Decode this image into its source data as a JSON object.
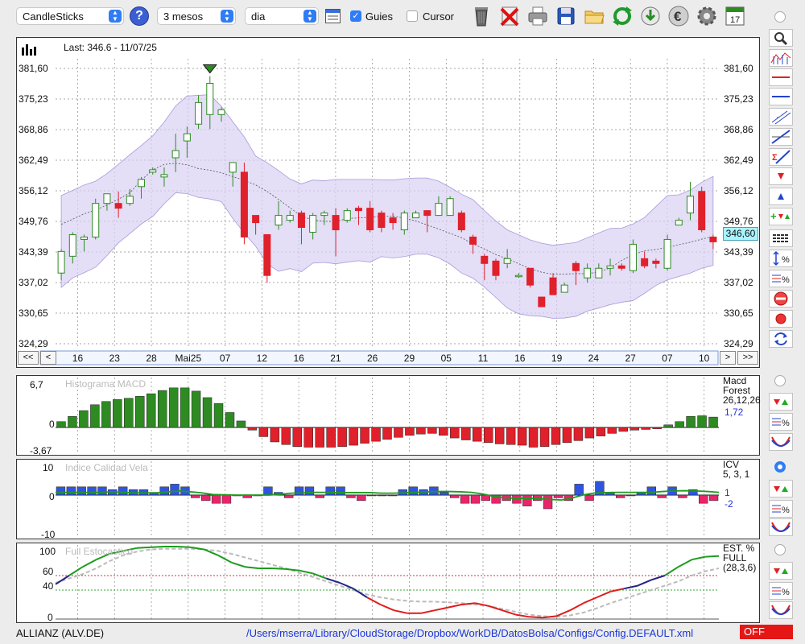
{
  "toolbar": {
    "chart_type": "CandleSticks",
    "period": "3 mesos",
    "interval": "dia",
    "guides_label": "Guies",
    "guides_checked": true,
    "cursor_label": "Cursor",
    "cursor_checked": false,
    "calendar_day": "17",
    "icons": [
      "help-icon",
      "table-icon",
      "trash-icon",
      "delete-icon",
      "print-icon",
      "save-icon",
      "folder-icon",
      "refresh-icon",
      "download-icon",
      "currency-icon",
      "settings-icon",
      "calendar-icon"
    ]
  },
  "main_chart": {
    "last_label": "Last: 346.6 - 11/07/25",
    "current_price": "346,60",
    "y_ticks": [
      "381,60",
      "375,23",
      "368,86",
      "362,49",
      "356,12",
      "349,76",
      "343,39",
      "337,02",
      "330,65",
      "324,29"
    ],
    "x_labels": [
      "16",
      "23",
      "28",
      "Mai25",
      "07",
      "12",
      "16",
      "21",
      "26",
      "29",
      "05",
      "11",
      "16",
      "19",
      "24",
      "27",
      "07",
      "10"
    ],
    "nav": {
      "first": "<<",
      "prev": "<",
      "next": ">",
      "last": ">>"
    },
    "colors": {
      "up": "#2e8b22",
      "down": "#e0202a",
      "band": "#d8d0f4",
      "band_edge": "#a89ad8",
      "accent": "#2f7cf6"
    }
  },
  "chart_data": [
    {
      "type": "candlestick",
      "title": "Last: 346.6 - 11/07/25",
      "ylim": [
        324.29,
        381.6
      ],
      "candles": [
        [
          339,
          343.5,
          337.5,
          344
        ],
        [
          342.5,
          347,
          341,
          347.5
        ],
        [
          346,
          346.5,
          343.5,
          347
        ],
        [
          346.5,
          353.5,
          346,
          354.5
        ],
        [
          353.5,
          355.5,
          352,
          355.5
        ],
        [
          353.5,
          352.5,
          350.5,
          356
        ],
        [
          353.5,
          355,
          353,
          356.5
        ],
        [
          357,
          358.5,
          354.5,
          359
        ],
        [
          360,
          360.5,
          359.5,
          361
        ],
        [
          359,
          359.5,
          357,
          361
        ],
        [
          363,
          364.5,
          360,
          368
        ],
        [
          366.5,
          368,
          363,
          369.5
        ],
        [
          370,
          374.5,
          369,
          376
        ],
        [
          372,
          378.5,
          369,
          380
        ],
        [
          372,
          373,
          370.5,
          373.5
        ],
        [
          360,
          362,
          357,
          362
        ],
        [
          360,
          346.5,
          345,
          362
        ],
        [
          351,
          349.5,
          347,
          351
        ],
        [
          347,
          338.5,
          337,
          347
        ],
        [
          349,
          351,
          348,
          354
        ],
        [
          350,
          351,
          349.5,
          352
        ],
        [
          351.5,
          348.5,
          345,
          352
        ],
        [
          347.5,
          351,
          346,
          351.5
        ],
        [
          351,
          351.5,
          349,
          352
        ],
        [
          351,
          348,
          342.5,
          352.5
        ],
        [
          350,
          352,
          349.5,
          352.5
        ],
        [
          352.5,
          352,
          349,
          353
        ],
        [
          352.5,
          348,
          347.5,
          354
        ],
        [
          351.5,
          348.5,
          347.5,
          352
        ],
        [
          350.5,
          349.5,
          348,
          351.5
        ],
        [
          348,
          351.5,
          347,
          352
        ],
        [
          350.5,
          351.5,
          350.5,
          352
        ],
        [
          352,
          351,
          347.5,
          352
        ],
        [
          351,
          353.5,
          351,
          355
        ],
        [
          351,
          354.5,
          351,
          355
        ],
        [
          351.5,
          348,
          347.5,
          352
        ],
        [
          346.5,
          345,
          343,
          347
        ],
        [
          342.5,
          341,
          337.5,
          343
        ],
        [
          341.5,
          338.5,
          337.5,
          342
        ],
        [
          341,
          342,
          340,
          344
        ],
        [
          338.5,
          338.5,
          338,
          339
        ],
        [
          340,
          336.5,
          336,
          340
        ],
        [
          334,
          332,
          332,
          334
        ],
        [
          338,
          334.5,
          334.5,
          339
        ],
        [
          335,
          336.5,
          335,
          337
        ],
        [
          341,
          339.5,
          336.5,
          341.5
        ],
        [
          338,
          340,
          337,
          341
        ],
        [
          338,
          340,
          338.5,
          341
        ],
        [
          340,
          340.5,
          338.5,
          342
        ],
        [
          340.5,
          340,
          339.5,
          341
        ],
        [
          339.5,
          345,
          339,
          346
        ],
        [
          342,
          340.5,
          340,
          343.5
        ],
        [
          341.5,
          341,
          340,
          342
        ],
        [
          340,
          346,
          339.5,
          347
        ],
        [
          349,
          350,
          349,
          350.5
        ],
        [
          351.5,
          355,
          350,
          358
        ],
        [
          356,
          348,
          347.5,
          357
        ],
        [
          346.5,
          345.5,
          344,
          347
        ]
      ]
    },
    {
      "type": "bar",
      "title": "Histograma MACD",
      "legend": [
        "Macd",
        "Forest",
        "26,12,26"
      ],
      "value_label": "1,72",
      "y_ticks": [
        "6,7",
        "0",
        "-3,67"
      ],
      "ylim": [
        -3.67,
        6.7
      ],
      "values": [
        0.9,
        1.7,
        2.6,
        3.5,
        4.0,
        4.3,
        4.5,
        4.8,
        5.2,
        5.7,
        6.1,
        6.1,
        5.6,
        4.6,
        3.7,
        2.3,
        1.0,
        -0.4,
        -1.4,
        -2.2,
        -2.6,
        -2.9,
        -3.0,
        -3.0,
        -3.0,
        -2.9,
        -2.7,
        -2.4,
        -2.1,
        -1.8,
        -1.5,
        -1.2,
        -1.0,
        -0.9,
        -1.2,
        -1.6,
        -1.9,
        -2.1,
        -2.3,
        -2.5,
        -2.6,
        -2.7,
        -3.0,
        -2.9,
        -2.6,
        -2.3,
        -2.0,
        -1.6,
        -1.3,
        -0.9,
        -0.6,
        -0.4,
        -0.3,
        -0.2,
        0.4,
        0.9,
        1.7,
        1.8,
        1.6
      ]
    },
    {
      "type": "bar",
      "title": "Indice Calidad Vela",
      "legend": [
        "ICV",
        "5, 3, 1"
      ],
      "value_labels": [
        "1",
        "-2"
      ],
      "y_ticks": [
        "10",
        "0",
        "-10"
      ],
      "ylim": [
        -10,
        10
      ],
      "values": [
        3,
        3,
        3,
        3,
        3,
        2,
        3,
        2,
        2,
        1,
        3,
        4,
        3,
        -1,
        -2,
        -3,
        -3,
        0,
        -1,
        0,
        3,
        1,
        -1,
        3,
        3,
        -1,
        3,
        3,
        -1,
        -2,
        0,
        0,
        0,
        2,
        3,
        2,
        3,
        1,
        -1,
        -3,
        -3,
        -2,
        -3,
        -2,
        -3,
        -4,
        -2,
        -5,
        -1,
        -2,
        4,
        -2,
        5,
        1,
        -1,
        0,
        1,
        3,
        -1,
        3,
        -1,
        2,
        -3,
        -2
      ],
      "line": [
        1,
        1,
        1,
        1,
        1,
        1.2,
        1,
        0.8,
        0.8,
        0.8,
        1.2,
        1.5,
        1.2,
        0.8,
        0.2,
        0.1,
        0,
        0,
        0,
        0,
        0.3,
        0.7,
        0.8,
        1,
        1,
        0.9,
        0.9,
        0.9,
        0.9,
        0.7,
        0.7,
        0.8,
        1,
        1.2,
        1.3,
        1.3,
        1.2,
        1,
        0.4,
        -0.5,
        -1,
        -1.2,
        -1.2,
        -1.3,
        -1.6,
        -1.8,
        -1,
        0.1,
        0.8,
        0.9,
        1,
        1,
        1,
        1,
        1.3,
        1.5,
        1.6,
        1.5,
        1.3,
        1
      ]
    },
    {
      "type": "line",
      "title": "Full Estocastico",
      "legend": [
        "EST. %",
        "FULL",
        "(28,3,6)"
      ],
      "y_ticks": [
        "100",
        "60",
        "40",
        "0"
      ],
      "ylim": [
        0,
        100
      ],
      "series": [
        {
          "values": [
            48,
            60,
            72,
            82,
            90,
            94,
            98,
            99,
            100,
            100,
            99,
            96,
            88,
            78,
            72,
            70,
            70,
            69,
            67,
            63,
            56,
            50,
            42,
            30,
            20,
            12,
            8,
            8,
            12,
            16,
            20,
            22,
            18,
            12,
            6,
            3,
            2,
            4,
            12,
            22,
            30,
            38,
            42,
            46,
            54,
            60,
            72,
            82,
            86,
            87
          ]
        },
        {
          "values": [
            50,
            56,
            62,
            70,
            80,
            88,
            93,
            96,
            97,
            97,
            97,
            96,
            94,
            90,
            85,
            80,
            75,
            70,
            64,
            58,
            52,
            46,
            40,
            34,
            30,
            27,
            25,
            24,
            24,
            23,
            22,
            20,
            18,
            14,
            10,
            6,
            4,
            3,
            5,
            9,
            15,
            22,
            28,
            34,
            40,
            46,
            52,
            60,
            66,
            70
          ]
        }
      ]
    }
  ],
  "status": {
    "ticker": "ALLIANZ (ALV.DE)",
    "path": "/Users/mserra/Library/CloudStorage/Dropbox/WorkDB/DatosBolsa/Configs/Config.DEFAULT.xml",
    "off_label": "OFF"
  }
}
